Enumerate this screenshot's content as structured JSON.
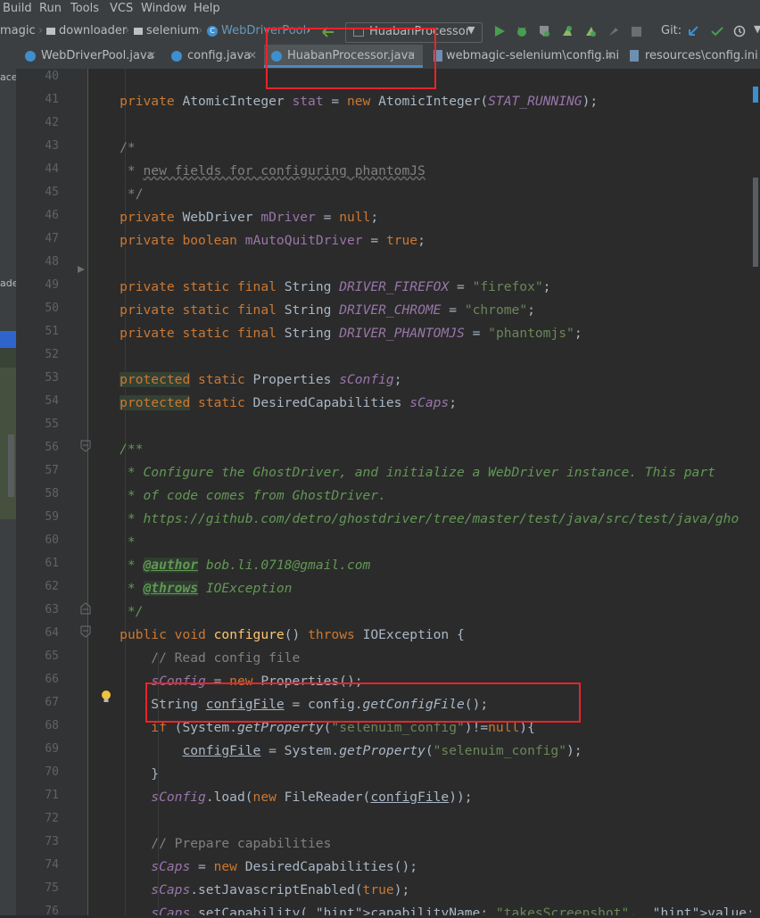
{
  "menubar": [
    "Build",
    "Run",
    "Tools",
    "VCS",
    "Window",
    "Help"
  ],
  "breadcrumbs": [
    "magic",
    "downloader",
    "selenium",
    "WebDriverPool"
  ],
  "run_config": "HuabanProcessor",
  "git_label": "Git:",
  "tabs": [
    {
      "label": "WebDriverPool.java",
      "icon": "class-icon"
    },
    {
      "label": "config.java",
      "icon": "class-icon"
    },
    {
      "label": "HuabanProcessor.java",
      "icon": "class-icon",
      "active": true
    },
    {
      "label": "webmagic-selenium\\config.ini",
      "icon": "ini-file-icon"
    },
    {
      "label": "resources\\config.ini",
      "icon": "ini-file-icon"
    }
  ],
  "side_panel_fragments": [
    "ace",
    "ade"
  ],
  "line_numbers": [
    "40",
    "41",
    "42",
    "43",
    "44",
    "45",
    "46",
    "47",
    "48",
    "49",
    "50",
    "51",
    "52",
    "53",
    "54",
    "55",
    "56",
    "57",
    "58",
    "59",
    "60",
    "61",
    "62",
    "63",
    "64",
    "65",
    "66",
    "67",
    "68",
    "69",
    "70",
    "71",
    "72",
    "73",
    "74",
    "75",
    "76"
  ],
  "code_lines": [
    "",
    "    private AtomicInteger stat = new AtomicInteger(STAT_RUNNING);",
    "",
    "    /*",
    "     * new fields for configuring phantomJS",
    "     */",
    "    private WebDriver mDriver = null;",
    "    private boolean mAutoQuitDriver = true;",
    "",
    "    private static final String DRIVER_FIREFOX = \"firefox\";",
    "    private static final String DRIVER_CHROME = \"chrome\";",
    "    private static final String DRIVER_PHANTOMJS = \"phantomjs\";",
    "",
    "    protected static Properties sConfig;",
    "    protected static DesiredCapabilities sCaps;",
    "",
    "    /**",
    "     * Configure the GhostDriver, and initialize a WebDriver instance. This part",
    "     * of code comes from GhostDriver.",
    "     * https://github.com/detro/ghostdriver/tree/master/test/java/src/test/java/gho",
    "     *",
    "     * @author bob.li.0718@gmail.com",
    "     * @throws IOException",
    "     */",
    "    public void configure() throws IOException {",
    "        // Read config file",
    "        sConfig = new Properties();",
    "        String configFile = config.getConfigFile();",
    "        if (System.getProperty(\"selenuim_config\")!=null){",
    "            configFile = System.getProperty(\"selenuim_config\");",
    "        }",
    "        sConfig.load(new FileReader(configFile));",
    "",
    "        // Prepare capabilities",
    "        sCaps = new DesiredCapabilities();",
    "        sCaps.setJavascriptEnabled(true);",
    "        sCaps.setCapability( capabilityName: \"takesScreenshot\",  value: false);"
  ],
  "hint_labels": {
    "capability_name": "capabilityName:",
    "value": "value:"
  },
  "colors": {
    "background": "#2b2b2b",
    "keyword": "#cc7832",
    "field": "#9876aa",
    "string": "#6a8759",
    "comment": "#808080",
    "javadoc": "#629755",
    "method": "#ffc66d",
    "highlight_box": "#e8242b"
  }
}
